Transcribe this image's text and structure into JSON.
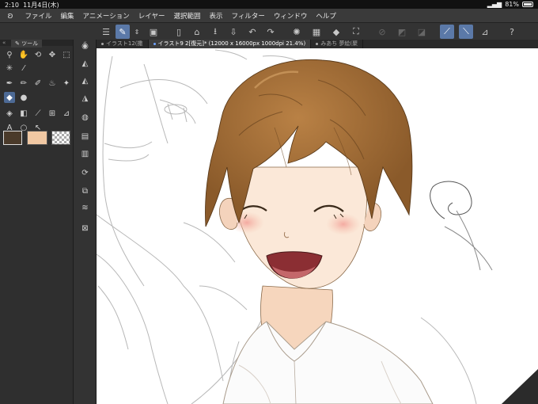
{
  "status": {
    "time": "2:10",
    "date": "11月4日(木)",
    "battery": "81%"
  },
  "menu": [
    "ファイル",
    "編集",
    "アニメーション",
    "レイヤー",
    "選択範囲",
    "表示",
    "フィルター",
    "ウィンドウ",
    "ヘルプ"
  ],
  "palette": {
    "tab_label": "ツール"
  },
  "tabs": [
    {
      "label": "イラスト12(撒"
    },
    {
      "label": "イラスト9 2[復元]* (12000 x 16000px 1000dpi 21.4%)"
    },
    {
      "label": "みあち 夢絵(聚"
    }
  ],
  "colors": {
    "main_color": "#4a3a2a",
    "sub_color": "#f1c8a3",
    "accent": "#5b79a8"
  }
}
